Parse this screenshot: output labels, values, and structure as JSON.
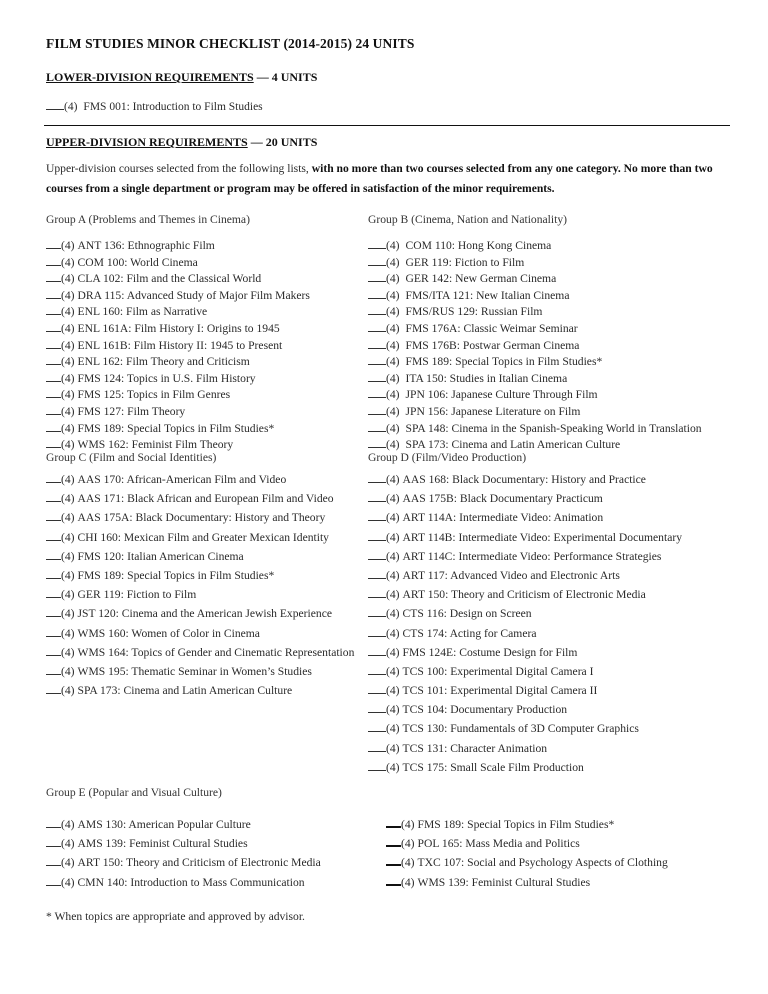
{
  "title": "FILM STUDIES MINOR CHECKLIST (2014-2015) 24 UNITS",
  "lower_division": {
    "heading": "LOWER-DIVISION REQUIREMENTS",
    "units": " — 4 UNITS",
    "courses": [
      {
        "units": "(4)",
        "name": "FMS 001: Introduction to Film Studies"
      }
    ]
  },
  "upper_division": {
    "heading": "UPPER-DIVISION REQUIREMENTS",
    "units": " — 20 UNITS",
    "intro_plain": "Upper-division courses selected from the following lists, ",
    "intro_bold": "with no more than two courses selected from any one category. No more than two courses from a single department or program may be offered in satisfaction of the minor requirements."
  },
  "groups": {
    "A": {
      "title": "Group A (Problems and Themes in Cinema)",
      "courses": [
        {
          "units": "(4)",
          "name": "ANT 136: Ethnographic Film"
        },
        {
          "units": "(4)",
          "name": "COM 100: World Cinema"
        },
        {
          "units": "(4)",
          "name": "CLA 102: Film and the Classical World"
        },
        {
          "units": "(4)",
          "name": "DRA 115: Advanced Study of Major Film Makers"
        },
        {
          "units": "(4)",
          "name": "ENL 160: Film as Narrative"
        },
        {
          "units": "(4)",
          "name": "ENL 161A: Film History I: Origins to 1945"
        },
        {
          "units": "(4)",
          "name": "ENL 161B: Film History II: 1945 to Present"
        },
        {
          "units": "(4)",
          "name": "ENL 162: Film Theory and Criticism"
        },
        {
          "units": "(4)",
          "name": "FMS 124: Topics in U.S. Film History"
        },
        {
          "units": "(4)",
          "name": "FMS 125: Topics in Film Genres"
        },
        {
          "units": "(4)",
          "name": "FMS 127: Film Theory"
        },
        {
          "units": "(4)",
          "name": "FMS 189: Special Topics in Film Studies*"
        },
        {
          "units": "(4)",
          "name": "WMS 162: Feminist Film Theory"
        }
      ]
    },
    "B": {
      "title": "Group B (Cinema, Nation and Nationality)",
      "courses": [
        {
          "units": "(4)",
          "name": "COM 110: Hong Kong Cinema"
        },
        {
          "units": "(4)",
          "name": "GER 119: Fiction to Film"
        },
        {
          "units": "(4)",
          "name": "GER 142: New German Cinema"
        },
        {
          "units": "(4)",
          "name": "FMS/ITA 121: New Italian Cinema"
        },
        {
          "units": "(4)",
          "name": "FMS/RUS 129: Russian Film"
        },
        {
          "units": "(4)",
          "name": "FMS 176A: Classic Weimar Seminar"
        },
        {
          "units": "(4)",
          "name": "FMS 176B: Postwar German Cinema"
        },
        {
          "units": "(4)",
          "name": "FMS 189: Special Topics in Film Studies*"
        },
        {
          "units": "(4)",
          "name": "ITA 150: Studies in Italian Cinema"
        },
        {
          "units": "(4)",
          "name": "JPN 106: Japanese Culture Through Film"
        },
        {
          "units": "(4)",
          "name": "JPN 156: Japanese Literature on Film"
        },
        {
          "units": "(4)",
          "name": "SPA 148: Cinema in the Spanish-Speaking World in Translation"
        },
        {
          "units": "(4)",
          "name": "SPA 173: Cinema and Latin American Culture"
        }
      ]
    },
    "C": {
      "title": "Group C (Film and Social Identities)",
      "courses": [
        {
          "units": "(4)",
          "name": "AAS 170: African-American Film and Video"
        },
        {
          "units": "(4)",
          "name": "AAS 171: Black African and European Film and Video"
        },
        {
          "units": "(4)",
          "name": "AAS 175A: Black Documentary: History and Theory"
        },
        {
          "units": "(4)",
          "name": "CHI 160: Mexican Film and Greater Mexican Identity"
        },
        {
          "units": "(4)",
          "name": "FMS 120: Italian American Cinema"
        },
        {
          "units": "(4)",
          "name": "FMS 189: Special Topics in Film Studies*"
        },
        {
          "units": "(4)",
          "name": "GER 119: Fiction to Film"
        },
        {
          "units": "(4)",
          "name": "JST 120: Cinema and the American Jewish Experience"
        },
        {
          "units": "(4)",
          "name": "WMS 160: Women of Color in Cinema"
        },
        {
          "units": "(4)",
          "name": "WMS 164: Topics of Gender and Cinematic Representation"
        },
        {
          "units": "(4)",
          "name": "WMS 195: Thematic Seminar in Women’s Studies"
        },
        {
          "units": "(4)",
          "name": "SPA 173: Cinema and Latin American Culture"
        }
      ]
    },
    "D": {
      "title": "Group D (Film/Video Production)",
      "courses": [
        {
          "units": "(4)",
          "name": "AAS 168: Black Documentary: History and Practice"
        },
        {
          "units": "(4)",
          "name": "AAS 175B: Black Documentary Practicum"
        },
        {
          "units": "(4)",
          "name": "ART 114A: Intermediate Video: Animation"
        },
        {
          "units": "(4)",
          "name": "ART 114B: Intermediate Video: Experimental Documentary"
        },
        {
          "units": "(4)",
          "name": "ART 114C: Intermediate Video: Performance Strategies"
        },
        {
          "units": "(4)",
          "name": "ART 117: Advanced Video and Electronic Arts"
        },
        {
          "units": "(4)",
          "name": "ART 150: Theory and Criticism of Electronic Media"
        },
        {
          "units": "(4)",
          "name": "CTS 116: Design on Screen"
        },
        {
          "units": "(4)",
          "name": "CTS 174: Acting for Camera"
        },
        {
          "units": "(4)",
          "name": "FMS 124E: Costume Design for Film"
        },
        {
          "units": "(4)",
          "name": "TCS 100: Experimental Digital Camera I"
        },
        {
          "units": "(4)",
          "name": "TCS 101: Experimental Digital Camera II"
        },
        {
          "units": "(4)",
          "name": "TCS 104: Documentary Production"
        },
        {
          "units": "(4)",
          "name": "TCS 130: Fundamentals of 3D Computer Graphics"
        },
        {
          "units": "(4)",
          "name": "TCS 131: Character Animation"
        },
        {
          "units": "(4)",
          "name": "TCS 175: Small Scale Film Production"
        }
      ]
    },
    "E": {
      "title": "Group E (Popular and Visual Culture)",
      "left": [
        {
          "units": "(4)",
          "name": "AMS 130: American Popular Culture"
        },
        {
          "units": "(4)",
          "name": "AMS 139: Feminist Cultural Studies"
        },
        {
          "units": "(4)",
          "name": "ART 150: Theory and Criticism of Electronic Media"
        },
        {
          "units": "(4)",
          "name": "CMN 140: Introduction to Mass Communication"
        }
      ],
      "right": [
        {
          "units": "(4)",
          "name": "FMS 189: Special Topics in Film Studies*"
        },
        {
          "units": "(4)",
          "name": "POL 165: Mass Media and Politics"
        },
        {
          "units": "(4)",
          "name": "TXC 107: Social and Psychology Aspects of Clothing"
        },
        {
          "units": "(4)",
          "name": "WMS 139: Feminist Cultural Studies"
        }
      ]
    }
  },
  "footnote": "* When topics are appropriate and approved by advisor."
}
